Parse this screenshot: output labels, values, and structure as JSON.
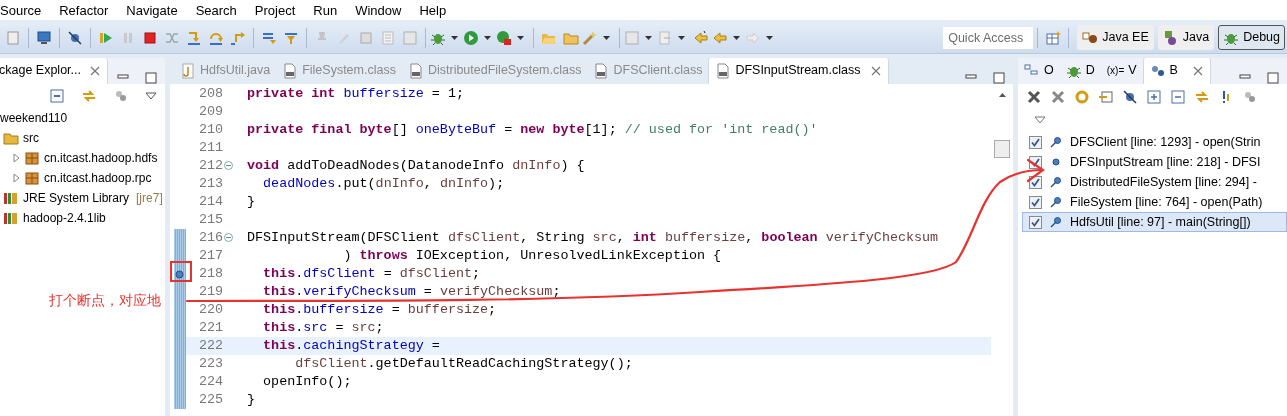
{
  "menu": [
    "Source",
    "Refactor",
    "Navigate",
    "Search",
    "Project",
    "Run",
    "Window",
    "Help"
  ],
  "quick_access": {
    "placeholder": "Quick Access"
  },
  "perspectives": [
    {
      "label": "Java EE",
      "selected": false
    },
    {
      "label": "Java",
      "selected": false
    },
    {
      "label": "Debug",
      "selected": true
    }
  ],
  "package_explorer": {
    "title": "ckage Explor...",
    "tree": [
      {
        "label": "weekend110",
        "children": [
          {
            "label": "src",
            "children": [
              {
                "label": "cn.itcast.hadoop.hdfs",
                "expanded": false
              },
              {
                "label": "cn.itcast.hadoop.rpc",
                "expanded": false
              }
            ]
          },
          {
            "label": "JRE System Library",
            "decoration": "[jre7]"
          },
          {
            "label": "hadoop-2.4.1lib"
          }
        ]
      }
    ]
  },
  "editor": {
    "tabs": [
      {
        "label": "HdfsUtil.java",
        "kind": "java",
        "selected": false
      },
      {
        "label": "FileSystem.class",
        "kind": "class",
        "selected": false
      },
      {
        "label": "DistributedFileSystem.class",
        "kind": "class",
        "selected": false
      },
      {
        "label": "DFSClient.class",
        "kind": "class",
        "selected": false
      },
      {
        "label": "DFSInputStream.class",
        "kind": "class",
        "selected": true
      }
    ],
    "lines": [
      {
        "number": "208",
        "fold": false,
        "breakpoint": false,
        "current": false,
        "range": false,
        "tokens": [
          {
            "kind": "keyword",
            "text": "private"
          },
          {
            "kind": "keyword",
            "text": " int"
          },
          {
            "kind": "field",
            "text": " buffersize"
          },
          {
            "kind": "plain",
            "text": " = 1;"
          }
        ]
      },
      {
        "number": "209",
        "fold": false,
        "breakpoint": false,
        "current": false,
        "range": false
      },
      {
        "number": "210",
        "fold": false,
        "breakpoint": false,
        "current": false,
        "range": false,
        "tokens": [
          {
            "kind": "keyword",
            "text": "private"
          },
          {
            "kind": "keyword",
            "text": " final"
          },
          {
            "kind": "keyword",
            "text": " byte"
          },
          {
            "kind": "plain",
            "text": "[] "
          },
          {
            "kind": "field",
            "text": "oneByteBuf"
          },
          {
            "kind": "plain",
            "text": " = "
          },
          {
            "kind": "keyword",
            "text": "new"
          },
          {
            "kind": "keyword",
            "text": " byte"
          },
          {
            "kind": "plain",
            "text": "[1]; "
          },
          {
            "kind": "comment",
            "text": "// used for 'int read()'"
          }
        ]
      },
      {
        "number": "211",
        "fold": false,
        "breakpoint": false,
        "current": false,
        "range": false
      },
      {
        "number": "212",
        "fold": true,
        "breakpoint": false,
        "current": false,
        "range": false,
        "tokens": [
          {
            "kind": "keyword",
            "text": "void"
          },
          {
            "kind": "plain",
            "text": " addToDeadNodes(DatanodeInfo "
          },
          {
            "kind": "param",
            "text": "dnInfo"
          },
          {
            "kind": "plain",
            "text": ") {"
          }
        ]
      },
      {
        "number": "213",
        "fold": false,
        "breakpoint": false,
        "current": false,
        "range": false,
        "tokens": [
          {
            "kind": "field",
            "text": "  deadNodes"
          },
          {
            "kind": "plain",
            "text": ".put("
          },
          {
            "kind": "param",
            "text": "dnInfo"
          },
          {
            "kind": "plain",
            "text": ", "
          },
          {
            "kind": "param",
            "text": "dnInfo"
          },
          {
            "kind": "plain",
            "text": ");"
          }
        ]
      },
      {
        "number": "214",
        "fold": false,
        "breakpoint": false,
        "current": false,
        "range": false,
        "tokens": [
          {
            "kind": "plain",
            "text": "}"
          }
        ]
      },
      {
        "number": "215",
        "fold": false,
        "breakpoint": false,
        "current": false,
        "range": false
      },
      {
        "number": "216",
        "fold": true,
        "breakpoint": false,
        "current": false,
        "range": true,
        "tokens": [
          {
            "kind": "plain",
            "text": "DFSInputStream(DFSClient "
          },
          {
            "kind": "param",
            "text": "dfsClient"
          },
          {
            "kind": "plain",
            "text": ", String "
          },
          {
            "kind": "param",
            "text": "src"
          },
          {
            "kind": "plain",
            "text": ", "
          },
          {
            "kind": "keyword",
            "text": "int"
          },
          {
            "kind": "param",
            "text": " buffersize"
          },
          {
            "kind": "plain",
            "text": ", "
          },
          {
            "kind": "keyword",
            "text": "boolean"
          },
          {
            "kind": "param",
            "text": " verifyChecksum"
          }
        ]
      },
      {
        "number": "217",
        "fold": false,
        "breakpoint": false,
        "current": false,
        "range": true,
        "tokens": [
          {
            "kind": "plain",
            "text": "            ) "
          },
          {
            "kind": "keyword",
            "text": "throws"
          },
          {
            "kind": "plain",
            "text": " IOException, UnresolvedLinkException {"
          }
        ]
      },
      {
        "number": "218",
        "fold": false,
        "breakpoint": true,
        "current": false,
        "range": true,
        "tokens": [
          {
            "kind": "keyword",
            "text": "  this"
          },
          {
            "kind": "plain",
            "text": "."
          },
          {
            "kind": "field",
            "text": "dfsClient"
          },
          {
            "kind": "plain",
            "text": " = "
          },
          {
            "kind": "param",
            "text": "dfsClient"
          },
          {
            "kind": "plain",
            "text": ";"
          }
        ]
      },
      {
        "number": "219",
        "fold": false,
        "breakpoint": false,
        "current": false,
        "range": true,
        "tokens": [
          {
            "kind": "keyword",
            "text": "  this"
          },
          {
            "kind": "plain",
            "text": "."
          },
          {
            "kind": "field",
            "text": "verifyChecksum"
          },
          {
            "kind": "plain",
            "text": " = "
          },
          {
            "kind": "param",
            "text": "verifyChecksum"
          },
          {
            "kind": "plain",
            "text": ";"
          }
        ]
      },
      {
        "number": "220",
        "fold": false,
        "breakpoint": false,
        "current": false,
        "range": true,
        "tokens": [
          {
            "kind": "keyword",
            "text": "  this"
          },
          {
            "kind": "plain",
            "text": "."
          },
          {
            "kind": "field",
            "text": "buffersize"
          },
          {
            "kind": "plain",
            "text": " = "
          },
          {
            "kind": "param",
            "text": "buffersize"
          },
          {
            "kind": "plain",
            "text": ";"
          }
        ]
      },
      {
        "number": "221",
        "fold": false,
        "breakpoint": false,
        "current": false,
        "range": true,
        "tokens": [
          {
            "kind": "keyword",
            "text": "  this"
          },
          {
            "kind": "plain",
            "text": "."
          },
          {
            "kind": "field",
            "text": "src"
          },
          {
            "kind": "plain",
            "text": " = "
          },
          {
            "kind": "param",
            "text": "src"
          },
          {
            "kind": "plain",
            "text": ";"
          }
        ]
      },
      {
        "number": "222",
        "fold": false,
        "breakpoint": false,
        "current": true,
        "range": true,
        "tokens": [
          {
            "kind": "keyword",
            "text": "  this"
          },
          {
            "kind": "plain",
            "text": "."
          },
          {
            "kind": "field",
            "text": "cachingStrategy"
          },
          {
            "kind": "plain",
            "text": " ="
          }
        ]
      },
      {
        "number": "223",
        "fold": false,
        "breakpoint": false,
        "current": false,
        "range": true,
        "tokens": [
          {
            "kind": "param",
            "text": "      dfsClient"
          },
          {
            "kind": "plain",
            "text": ".getDefaultReadCachingStrategy();"
          }
        ]
      },
      {
        "number": "224",
        "fold": false,
        "breakpoint": false,
        "current": false,
        "range": true,
        "tokens": [
          {
            "kind": "plain",
            "text": "  openInfo();"
          }
        ]
      },
      {
        "number": "225",
        "fold": false,
        "breakpoint": false,
        "current": false,
        "range": true,
        "tokens": [
          {
            "kind": "plain",
            "text": "}"
          }
        ]
      }
    ]
  },
  "right_panel": {
    "tabs": [
      {
        "label": "O",
        "kind": "outline",
        "selected": false
      },
      {
        "label": "D",
        "kind": "debug",
        "selected": false
      },
      {
        "label": "V",
        "kind": "variables",
        "prefix": "(x)=",
        "selected": false
      },
      {
        "label": "B",
        "kind": "breakpoints",
        "selected": true
      }
    ],
    "breakpoints": [
      {
        "label": "DFSClient [line: 1293] - open(Strin",
        "checked": true,
        "installed": true,
        "selected": false
      },
      {
        "label": "DFSInputStream [line: 218] - DFSI",
        "checked": true,
        "installed": false,
        "selected": false
      },
      {
        "label": "DistributedFileSystem [line: 294] -",
        "checked": true,
        "installed": true,
        "selected": false
      },
      {
        "label": "FileSystem [line: 764] - open(Path)",
        "checked": true,
        "installed": true,
        "selected": false
      },
      {
        "label": "HdfsUtil [line: 97] - main(String[])",
        "checked": true,
        "installed": true,
        "selected": true
      }
    ]
  },
  "annotation": {
    "text": "打个断点，对应地"
  }
}
